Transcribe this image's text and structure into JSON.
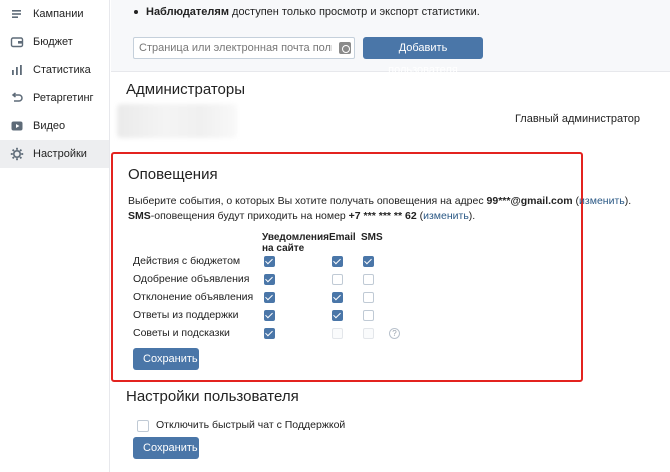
{
  "sidebar": {
    "items": [
      {
        "label": "Кампании",
        "icon": "campaigns-icon"
      },
      {
        "label": "Бюджет",
        "icon": "wallet-icon"
      },
      {
        "label": "Статистика",
        "icon": "stats-icon"
      },
      {
        "label": "Ретаргетинг",
        "icon": "retarget-icon"
      },
      {
        "label": "Видео",
        "icon": "video-icon"
      },
      {
        "label": "Настройки",
        "icon": "gear-icon",
        "active": true
      }
    ]
  },
  "access": {
    "bullet_bold": "Наблюдателям",
    "bullet_rest": " доступен только просмотр и экспорт статистики.",
    "input_placeholder": "Страница или электронная почта пользователя",
    "add_button": "Добавить пользователя"
  },
  "admins": {
    "title": "Администраторы",
    "role": "Главный администратор"
  },
  "notifications": {
    "title": "Оповещения",
    "line1_prefix": "Выберите события, о которых Вы хотите получать оповещения на адрес ",
    "email": "99***@gmail.com",
    "open_paren": " (",
    "change_link": "изменить",
    "close_paren": ").",
    "line2_bold": "SMS",
    "line2_text": "-оповещения будут приходить на номер ",
    "phone": "+7 *** *** ** 62",
    "columns": {
      "site_line1": "Уведомления",
      "site_line2": "на сайте",
      "email": "Email",
      "sms": "SMS"
    },
    "rows": [
      {
        "label": "Действия с бюджетом",
        "site": "on",
        "email": "on",
        "sms": "on"
      },
      {
        "label": "Одобрение объявления",
        "site": "on",
        "email": "off",
        "sms": "off"
      },
      {
        "label": "Отклонение объявления",
        "site": "on",
        "email": "on",
        "sms": "off"
      },
      {
        "label": "Ответы из поддержки",
        "site": "on",
        "email": "on",
        "sms": "off"
      },
      {
        "label": "Советы и подсказки",
        "site": "on",
        "email": "disabled",
        "sms": "disabled"
      }
    ],
    "help_glyph": "?",
    "save_button": "Сохранить"
  },
  "user_settings": {
    "title": "Настройки пользователя",
    "quick_chat_label": "Отключить быстрый чат с Поддержкой",
    "save_button": "Сохранить"
  },
  "colors": {
    "accent": "#4a76a8",
    "highlight_border": "#e3231f",
    "link": "#2a5885"
  }
}
